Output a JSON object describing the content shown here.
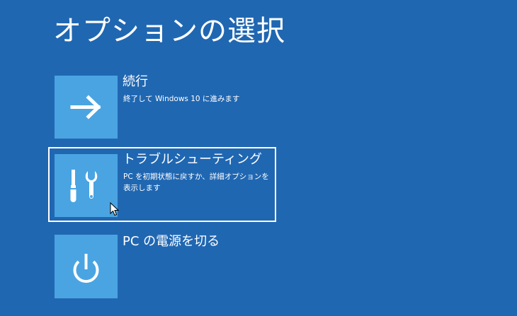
{
  "page": {
    "title": "オプションの選択"
  },
  "options": [
    {
      "title": "続行",
      "description": "終了して Windows 10 に進みます",
      "icon": "arrow-right-icon"
    },
    {
      "title": "トラブルシューティング",
      "description": "PC を初期状態に戻すか、詳細オプションを表示します",
      "icon": "tools-icon"
    },
    {
      "title": "PC の電源を切る",
      "description": "",
      "icon": "power-icon"
    }
  ],
  "colors": {
    "background": "#2067b2",
    "tile": "#4aa4e2",
    "text": "#ffffff",
    "focus_border": "#ffffff"
  }
}
